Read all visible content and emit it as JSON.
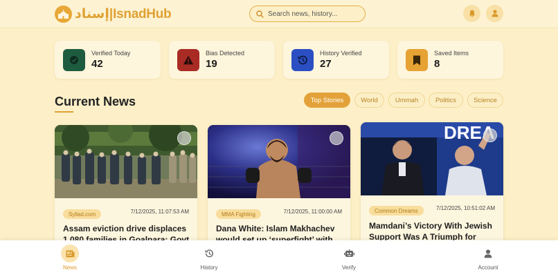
{
  "header": {
    "logo_arabic": "إسناد",
    "logo_sep": "|",
    "logo_latin": "IsnadHub",
    "search_placeholder": "Search news, history..."
  },
  "stats": [
    {
      "label": "Verified Today",
      "value": "42",
      "icon": "check-circle-icon",
      "color": "#1e5c3f"
    },
    {
      "label": "Bias Detected",
      "value": "19",
      "icon": "warning-icon",
      "color": "#a82b24"
    },
    {
      "label": "History Verified",
      "value": "27",
      "icon": "history-icon",
      "color": "#2b4fc3"
    },
    {
      "label": "Saved Items",
      "value": "8",
      "icon": "bookmark-icon",
      "color": "#e6a233"
    }
  ],
  "section": {
    "title": "Current News"
  },
  "tabs": [
    "Top Stories",
    "World",
    "Ummah",
    "Politics",
    "Science"
  ],
  "active_tab": "Top Stories",
  "news": [
    {
      "source": "Syllad.com",
      "date": "7/12/2025, 11:07:53 AM",
      "title": "Assam eviction drive displaces 1,080 families in Goalpara: Govt"
    },
    {
      "source": "MMA Fighting",
      "date": "7/12/2025, 11:00:00 AM",
      "title": "Dana White: Islam Makhachev would set up ‘superfight’ with Ilia"
    },
    {
      "source": "Common Dreams",
      "date": "7/12/2025, 10:51:02 AM",
      "title": "Mamdani’s Victory With Jewish Support Was A Triumph for"
    }
  ],
  "nav": [
    {
      "label": "News",
      "icon": "newspaper-icon",
      "active": true
    },
    {
      "label": "History",
      "icon": "history-icon",
      "active": false
    },
    {
      "label": "Verify",
      "icon": "robot-icon",
      "active": false
    },
    {
      "label": "Account",
      "icon": "user-icon",
      "active": false
    }
  ],
  "colors": {
    "accent": "#e3a239",
    "background": "#fdf0c8"
  }
}
